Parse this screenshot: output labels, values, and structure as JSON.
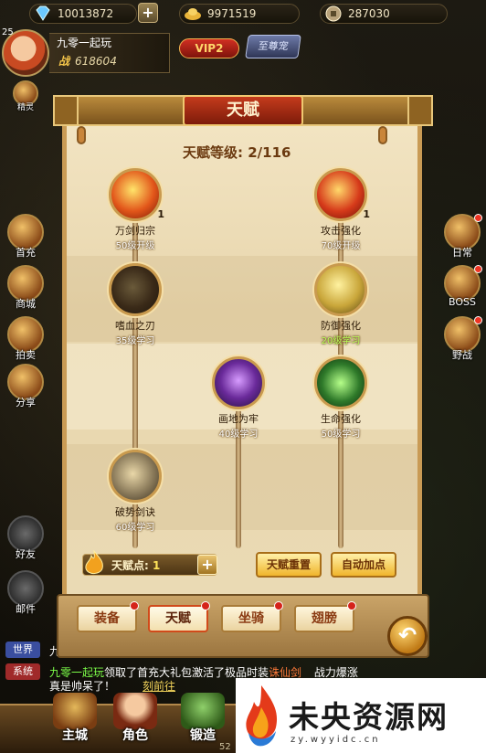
{
  "currency": {
    "diamonds": "10013872",
    "gold": "9971519",
    "coins": "287030"
  },
  "player": {
    "level": "25",
    "name": "九零一起玩",
    "power_label": "战",
    "power": "618604",
    "vip": "VIP2",
    "badge": "至尊宠"
  },
  "left_menu": [
    {
      "label": "精灵"
    },
    {
      "label": "首充"
    },
    {
      "label": "商城"
    },
    {
      "label": "拍卖"
    },
    {
      "label": "分享"
    },
    {
      "label": "好友"
    },
    {
      "label": "邮件"
    }
  ],
  "right_menu": [
    {
      "label": "日常"
    },
    {
      "label": "BOSS"
    },
    {
      "label": "野战"
    }
  ],
  "talent": {
    "title": "天赋",
    "level_label": "天赋等级:",
    "level_value": "2/116",
    "nodes": [
      {
        "name": "万剑归宗",
        "req": "50级开级",
        "points": "1"
      },
      {
        "name": "攻击强化",
        "req": "70级开级",
        "points": "1"
      },
      {
        "name": "嗜血之刃",
        "req": "35级学习",
        "points": ""
      },
      {
        "name": "防御强化",
        "req": "20级学习",
        "points": ""
      },
      {
        "name": "画地为牢",
        "req": "40级学习",
        "points": ""
      },
      {
        "name": "生命强化",
        "req": "50级学习",
        "points": ""
      },
      {
        "name": "破势剑诀",
        "req": "60级学习",
        "points": ""
      }
    ],
    "points_label": "天赋点:",
    "points_value": "1",
    "reset_button": "天赋重置",
    "auto_button": "自动加点"
  },
  "tabs": [
    "装备",
    "天赋",
    "坐骑",
    "翅膀"
  ],
  "chat": {
    "world_tag": "世界",
    "world_text": "九",
    "system_tag": "系统",
    "system_name": "九零一起玩",
    "system_text": "领取了首充大礼包激活了极品时装",
    "system_item": "诛仙剑",
    "system_tail": "战力爆涨",
    "system_line2": "真是帅呆了！",
    "system_link": "刻前往"
  },
  "bottom_nav": [
    "主城",
    "角色",
    "锻造"
  ],
  "bottom_number": "52",
  "logo": {
    "title": "未央资源网",
    "url": "zy.wyyidc.cn"
  }
}
